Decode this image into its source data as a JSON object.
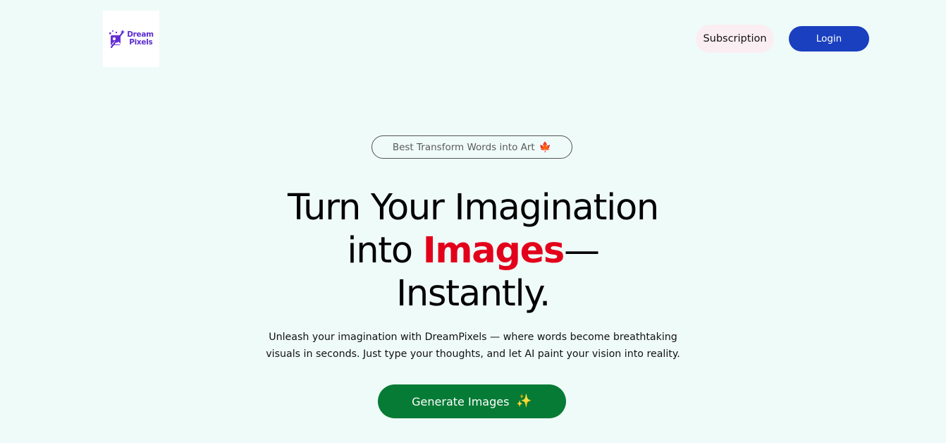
{
  "brand": {
    "name_line1": "Dream",
    "name_line2": "Pixels",
    "logo_icon": "magic-wand-image-icon",
    "color": "#5b2ccf"
  },
  "nav": {
    "subscription_label": "Subscription",
    "login_label": "Login"
  },
  "badge": {
    "text": "Best Transform Words into Art",
    "icon": "maple-leaf-icon",
    "icon_glyph": "🍁"
  },
  "hero": {
    "title_line1": "Turn Your Imagination",
    "title_into": "into ",
    "title_highlight": "Images",
    "title_dash": "—",
    "title_line3": "Instantly.",
    "subtitle_line1": "Unleash your imagination with DreamPixels — where words become breathtaking",
    "subtitle_line2": "visuals in seconds. Just type your thoughts, and let AI paint your vision into reality."
  },
  "cta": {
    "label": "Generate Images",
    "icon": "sparkles-icon",
    "icon_glyph": "✨"
  },
  "colors": {
    "background": "#effbf8",
    "highlight": "#e3001b",
    "login_button": "#1a3fbf",
    "cta_button": "#067b35",
    "subscription_button": "#fbeef2"
  }
}
